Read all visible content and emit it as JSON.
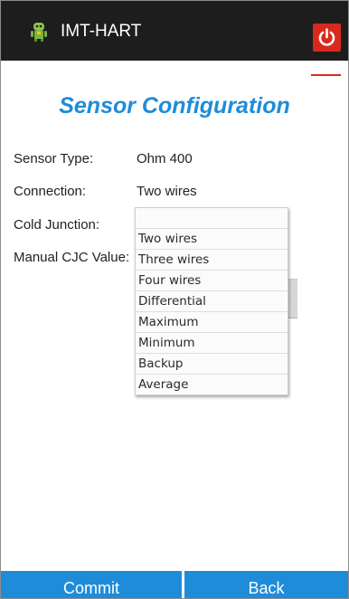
{
  "app": {
    "title": "IMT-HART",
    "icon": "android-robot-icon",
    "power_icon": "power-icon",
    "accent_color": "#1f8cd9",
    "power_color": "#d9291c"
  },
  "page": {
    "title": "Sensor Configuration"
  },
  "form": {
    "rows": [
      {
        "label": "Sensor Type:",
        "value": "Ohm 400"
      },
      {
        "label": "Connection:",
        "value": "Two wires"
      },
      {
        "label": "Cold Junction:",
        "value": ""
      },
      {
        "label": "Manual CJC Value:",
        "value": ""
      }
    ]
  },
  "dropdown": {
    "options": [
      "Two wires",
      "Three wires",
      "Four wires",
      "Differential",
      "Maximum",
      "Minimum",
      "Backup",
      "Average"
    ]
  },
  "buttons": {
    "commit": "Commit",
    "back": "Back"
  }
}
